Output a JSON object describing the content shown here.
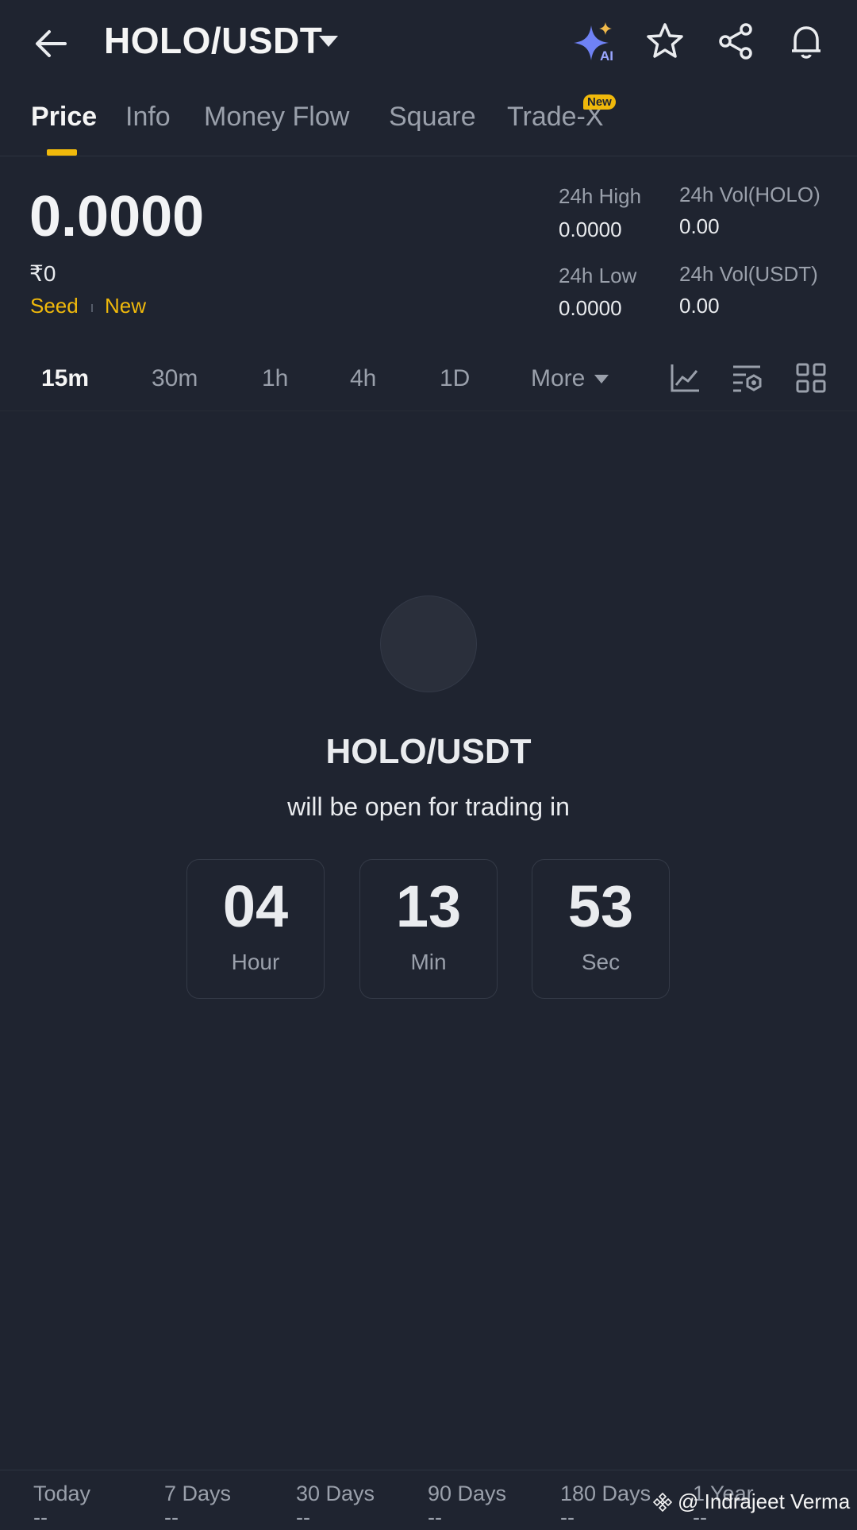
{
  "header": {
    "title": "HOLO/USDT",
    "ai_label": "AI",
    "icons": [
      "back-arrow-icon",
      "dropdown-caret-icon",
      "ai-sparkle-icon",
      "star-icon",
      "share-icon",
      "bell-icon"
    ]
  },
  "tabs": [
    {
      "label": "Price",
      "active": true
    },
    {
      "label": "Info"
    },
    {
      "label": "Money Flow"
    },
    {
      "label": "Square"
    },
    {
      "label": "Trade-X",
      "badge": "New"
    }
  ],
  "price": {
    "last": "0.0000",
    "fiat": "₹0",
    "tags": [
      "Seed",
      "New"
    ]
  },
  "stats": {
    "high_label": "24h High",
    "high_value": "0.0000",
    "low_label": "24h Low",
    "low_value": "0.0000",
    "vol_base_label": "24h Vol(HOLO)",
    "vol_base_value": "0.00",
    "vol_quote_label": "24h Vol(USDT)",
    "vol_quote_value": "0.00"
  },
  "intervals": [
    {
      "label": "15m",
      "active": true
    },
    {
      "label": "30m"
    },
    {
      "label": "1h"
    },
    {
      "label": "4h"
    },
    {
      "label": "1D"
    },
    {
      "label": "More"
    }
  ],
  "tool_icons": [
    "chart-indicator-icon",
    "chart-settings-icon",
    "grid-layout-icon"
  ],
  "launch": {
    "pair": "HOLO/USDT",
    "message": "will be open for trading in",
    "countdown": [
      {
        "value": "04",
        "unit": "Hour"
      },
      {
        "value": "13",
        "unit": "Min"
      },
      {
        "value": "53",
        "unit": "Sec"
      }
    ]
  },
  "performance": [
    {
      "label": "Today",
      "value": "--"
    },
    {
      "label": "7 Days",
      "value": "--"
    },
    {
      "label": "30 Days",
      "value": "--"
    },
    {
      "label": "90 Days",
      "value": "--"
    },
    {
      "label": "180 Days",
      "value": "--"
    },
    {
      "label": "1 Year",
      "value": "--"
    }
  ],
  "watermark": "@ Indrajeet   Verma",
  "colors": {
    "background": "#1f2430",
    "accent": "#f0b90b",
    "muted_text": "#9aa0ab",
    "ai_icon": "#7b8cf7"
  }
}
